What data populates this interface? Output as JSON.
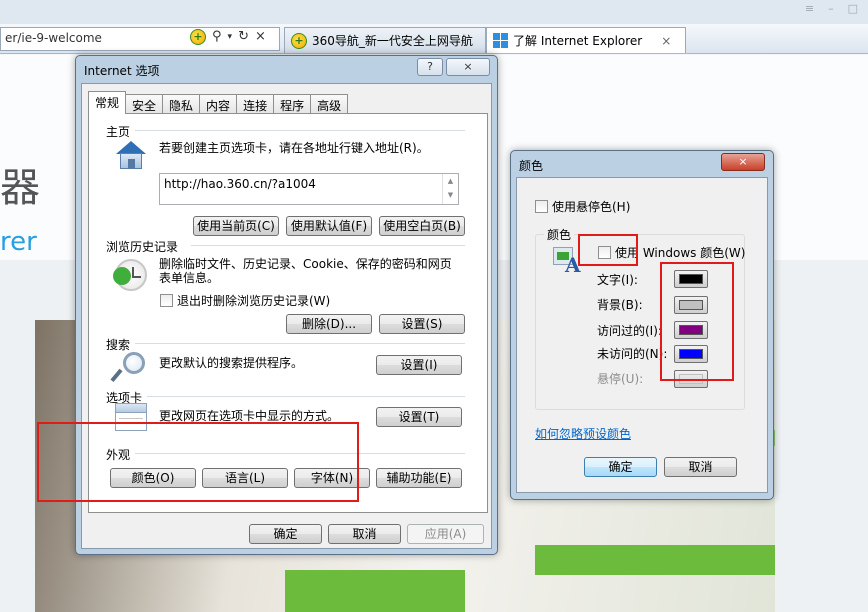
{
  "browser": {
    "address_text": "er/ie-9-welcome",
    "tabs": [
      {
        "label": "360导航_新一代安全上网导航",
        "active": false
      },
      {
        "label": "了解 Internet Explorer",
        "active": true,
        "close": "×"
      }
    ],
    "nav_icons": [
      "search-icon",
      "refresh-icon",
      "stop-icon"
    ]
  },
  "page": {
    "title_fragment": "器",
    "subtitle_fragment": "rer"
  },
  "internet_options": {
    "title": "Internet 选项",
    "help": "?",
    "close": "×",
    "tabs": [
      "常规",
      "安全",
      "隐私",
      "内容",
      "连接",
      "程序",
      "高级"
    ],
    "active_tab": "常规",
    "home": {
      "label": "主页",
      "desc": "若要创建主页选项卡，请在各地址行键入地址(R)。",
      "url": "http://hao.360.cn/?a1004",
      "buttons": {
        "current": "使用当前页(C)",
        "default": "使用默认值(F)",
        "blank": "使用空白页(B)"
      }
    },
    "history": {
      "label": "浏览历史记录",
      "desc": "删除临时文件、历史记录、Cookie、保存的密码和网页表单信息。",
      "checkbox": "退出时删除浏览历史记录(W)",
      "checked": false,
      "buttons": {
        "delete": "删除(D)...",
        "settings": "设置(S)"
      }
    },
    "search": {
      "label": "搜索",
      "desc": "更改默认的搜索提供程序。",
      "button": "设置(I)"
    },
    "tabs_section": {
      "label": "选项卡",
      "desc": "更改网页在选项卡中显示的方式。",
      "button": "设置(T)"
    },
    "appearance": {
      "label": "外观",
      "buttons": {
        "colors": "颜色(O)",
        "languages": "语言(L)",
        "fonts": "字体(N)",
        "accessibility": "辅助功能(E)"
      }
    },
    "footer": {
      "ok": "确定",
      "cancel": "取消",
      "apply": "应用(A)"
    }
  },
  "colors_dialog": {
    "title": "颜色",
    "close": "×",
    "hover_checkbox": "使用悬停色(H)",
    "hover_checked": false,
    "group_label": "颜色",
    "windows_colors_checkbox": "使用 Windows 颜色(W)",
    "windows_colors_checked": false,
    "rows": [
      {
        "label": "文字(I):",
        "color": "#000000",
        "enabled": true
      },
      {
        "label": "背景(B):",
        "color": "#c0c0c0",
        "enabled": true
      },
      {
        "label": "访问过的(I):",
        "color": "#800080",
        "enabled": true
      },
      {
        "label": "未访问的(N):",
        "color": "#0000ff",
        "enabled": true
      },
      {
        "label": "悬停(U):",
        "color": "",
        "enabled": false
      }
    ],
    "link": "如何忽略预设颜色",
    "ok": "确定",
    "cancel": "取消"
  },
  "annotation_color": "#e11a1a"
}
